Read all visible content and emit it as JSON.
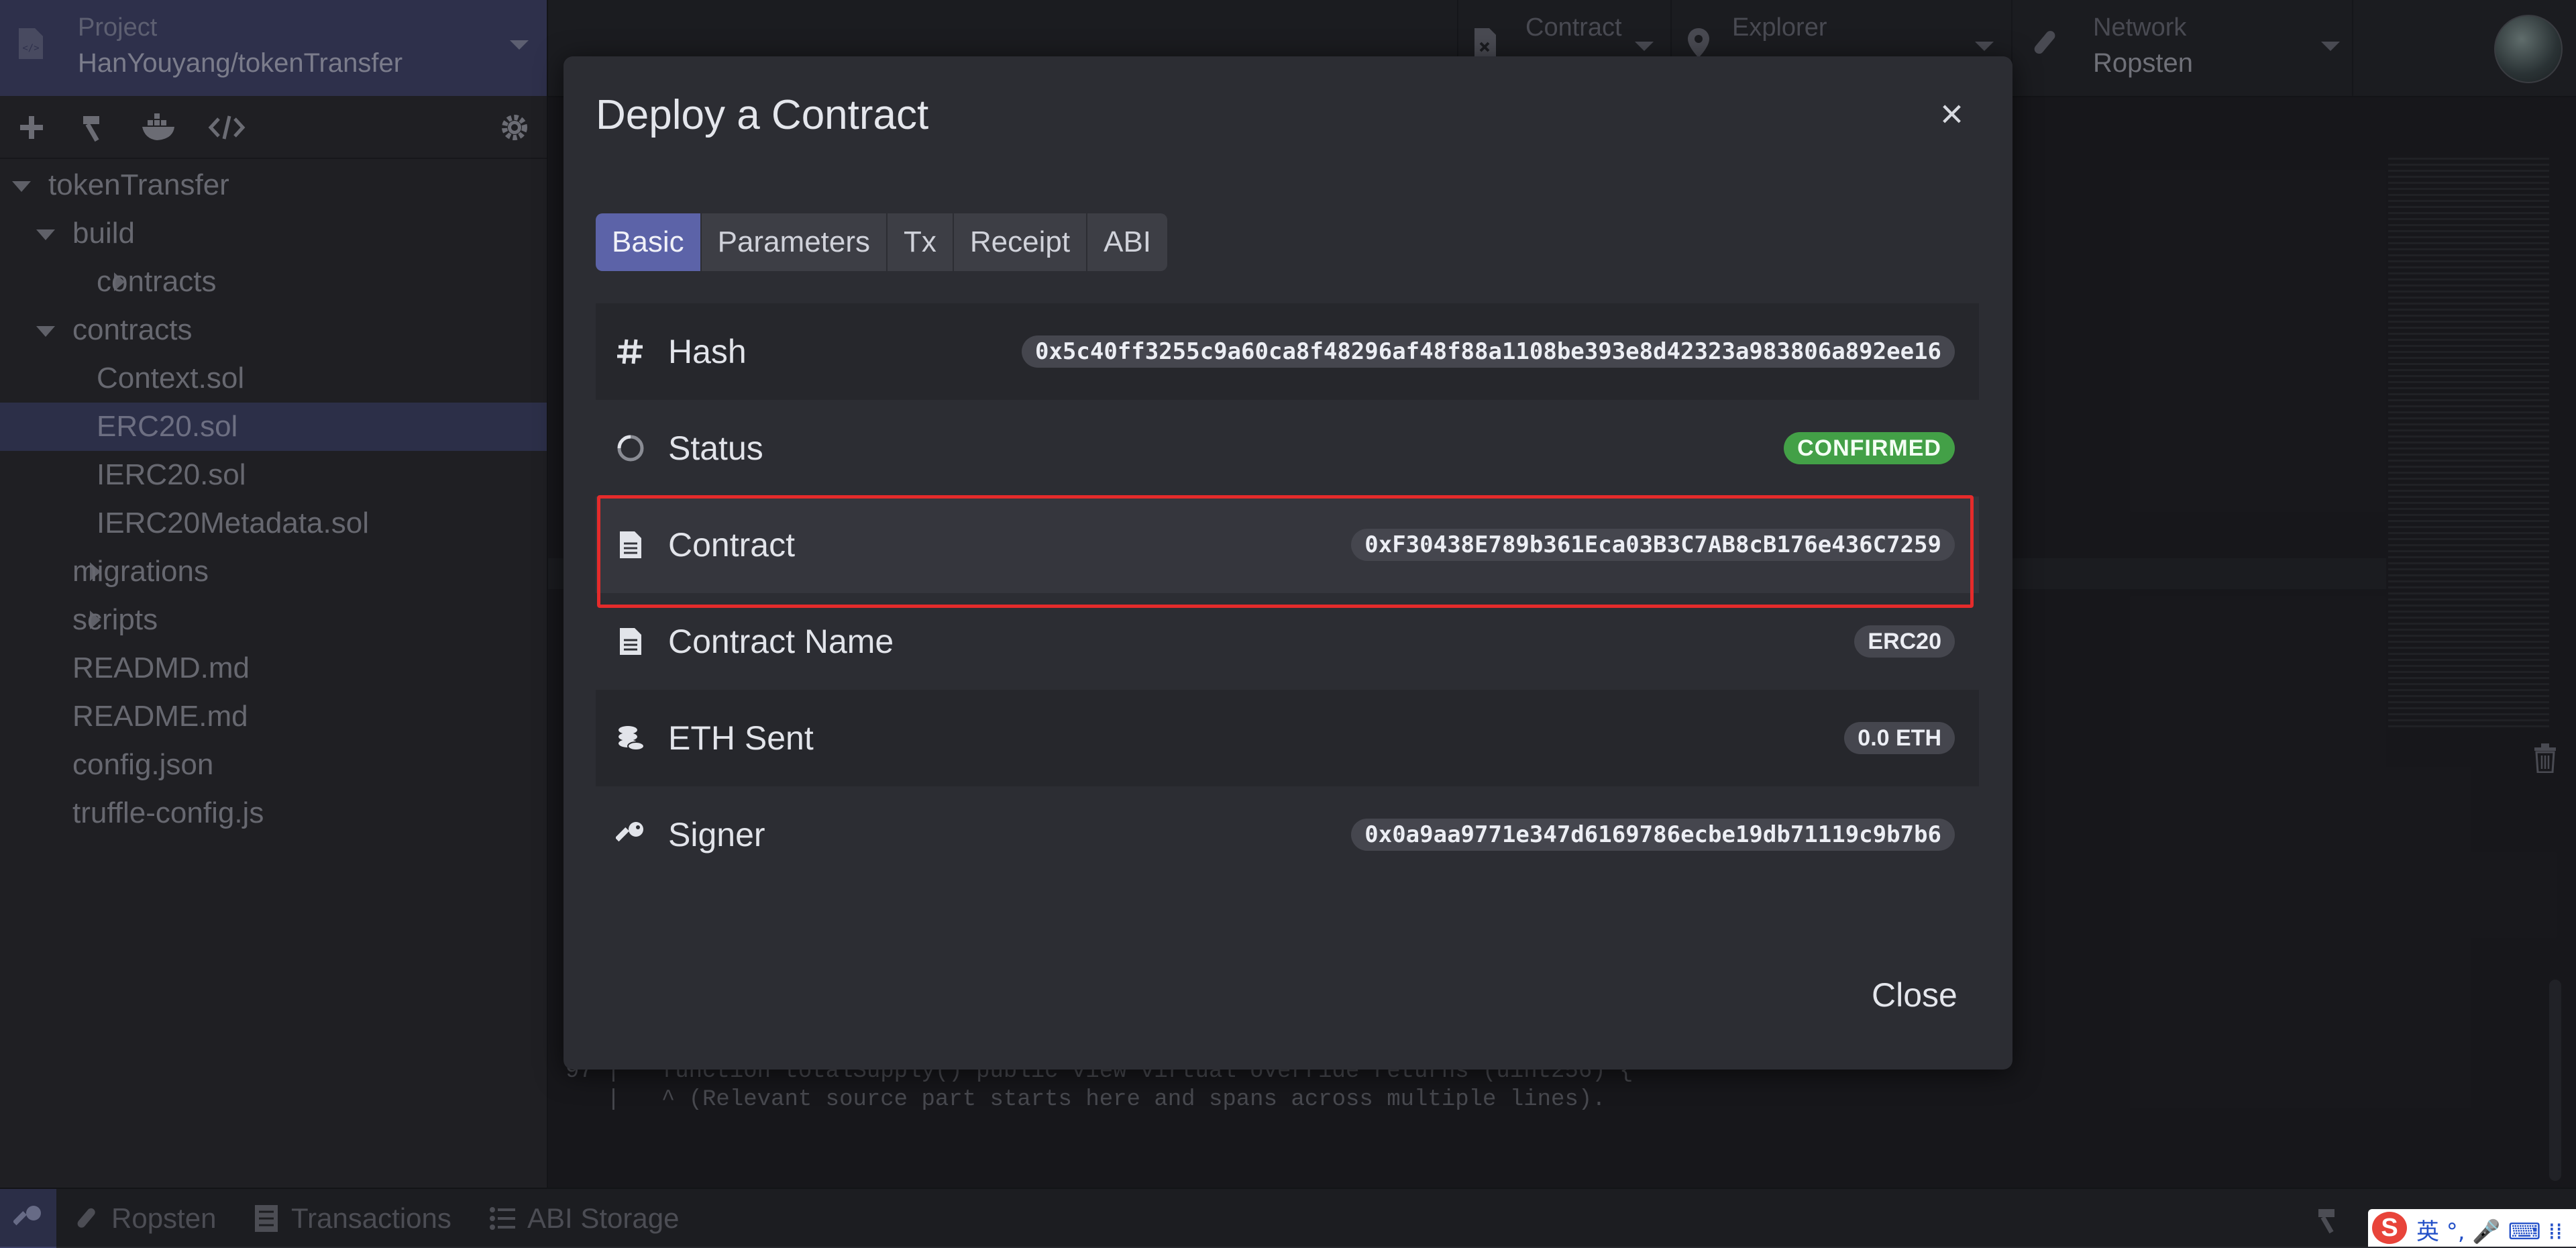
{
  "project": {
    "label": "Project",
    "name": "HanYouyang/tokenTransfer"
  },
  "file_tree": [
    {
      "label": "tokenTransfer",
      "indent": 0,
      "expander": "down"
    },
    {
      "label": "build",
      "indent": 1,
      "expander": "down"
    },
    {
      "label": "contracts",
      "indent": 2,
      "expander": "right"
    },
    {
      "label": "contracts",
      "indent": 1,
      "expander": "down"
    },
    {
      "label": "Context.sol",
      "indent": 2,
      "expander": "none"
    },
    {
      "label": "ERC20.sol",
      "indent": 2,
      "expander": "none",
      "selected": true
    },
    {
      "label": "IERC20.sol",
      "indent": 2,
      "expander": "none"
    },
    {
      "label": "IERC20Metadata.sol",
      "indent": 2,
      "expander": "none"
    },
    {
      "label": "migrations",
      "indent": 1,
      "expander": "right"
    },
    {
      "label": "scripts",
      "indent": 1,
      "expander": "right"
    },
    {
      "label": "READMD.md",
      "indent": 1,
      "expander": "none"
    },
    {
      "label": "README.md",
      "indent": 1,
      "expander": "none"
    },
    {
      "label": "config.json",
      "indent": 1,
      "expander": "none"
    },
    {
      "label": "truffle-config.js",
      "indent": 1,
      "expander": "none"
    }
  ],
  "topbar": {
    "contract": {
      "label": "Contract",
      "value": ""
    },
    "explorer": {
      "label": "Explorer",
      "value": ""
    },
    "network": {
      "label": "Network",
      "value": "Ropsten"
    }
  },
  "editor": {
    "log_line1": "97 |   function totalSupply() public view virtual override returns (uint256) {",
    "log_line2": "   |   ^ (Relevant source part starts here and spans across multiple lines)."
  },
  "statusbar": {
    "network": "Ropsten",
    "transactions": "Transactions",
    "abi_storage": "ABI Storage"
  },
  "modal": {
    "title": "Deploy a Contract",
    "close_x": "×",
    "tabs": [
      "Basic",
      "Parameters",
      "Tx",
      "Receipt",
      "ABI"
    ],
    "active_tab": "Basic",
    "rows": {
      "hash": {
        "label": "Hash",
        "value": "0x5c40ff3255c9a60ca8f48296af48f88a1108be393e8d42323a983806a892ee16"
      },
      "status": {
        "label": "Status",
        "value": "CONFIRMED"
      },
      "contract": {
        "label": "Contract",
        "value": "0xF30438E789b361Eca03B3C7AB8cB176e436C7259"
      },
      "contract_name": {
        "label": "Contract Name",
        "value": "ERC20"
      },
      "eth_sent": {
        "label": "ETH Sent",
        "value": "0.0 ETH"
      },
      "signer": {
        "label": "Signer",
        "value": "0x0a9aa9771e347d6169786ecbe19db71119c9b7b6"
      }
    },
    "close_button": "Close"
  },
  "ime": {
    "logo": "S",
    "text": "英 °, 🎤 ⌨ ⁞⁞"
  },
  "colors": {
    "accent": "#5c63a8",
    "confirmed": "#43a047",
    "highlight_border": "#e52b2b"
  }
}
